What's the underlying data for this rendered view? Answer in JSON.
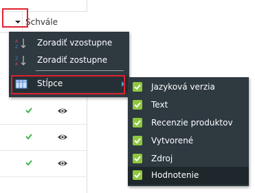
{
  "grid": {
    "header_label": "Schvále",
    "rows": [
      {
        "approved": true,
        "visible": true
      },
      {
        "approved": true,
        "visible": true
      },
      {
        "approved": true,
        "visible": true
      }
    ]
  },
  "menu": {
    "sort_asc": "Zoradiť vzostupne",
    "sort_desc": "Zoradiť zostupne",
    "columns": "Stĺpce"
  },
  "submenu": {
    "items": [
      {
        "label": "Jazyková verzia",
        "checked": true
      },
      {
        "label": "Text",
        "checked": true
      },
      {
        "label": "Recenzie produktov",
        "checked": true
      },
      {
        "label": "Vytvorené",
        "checked": true
      },
      {
        "label": "Zdroj",
        "checked": true
      },
      {
        "label": "Hodnotenie",
        "checked": true
      }
    ]
  },
  "colors": {
    "menu_bg": "#2e3940",
    "check_green": "#8ec73f",
    "highlight_red": "#e0202b",
    "submenu_arrow": "#4aa3d8"
  }
}
